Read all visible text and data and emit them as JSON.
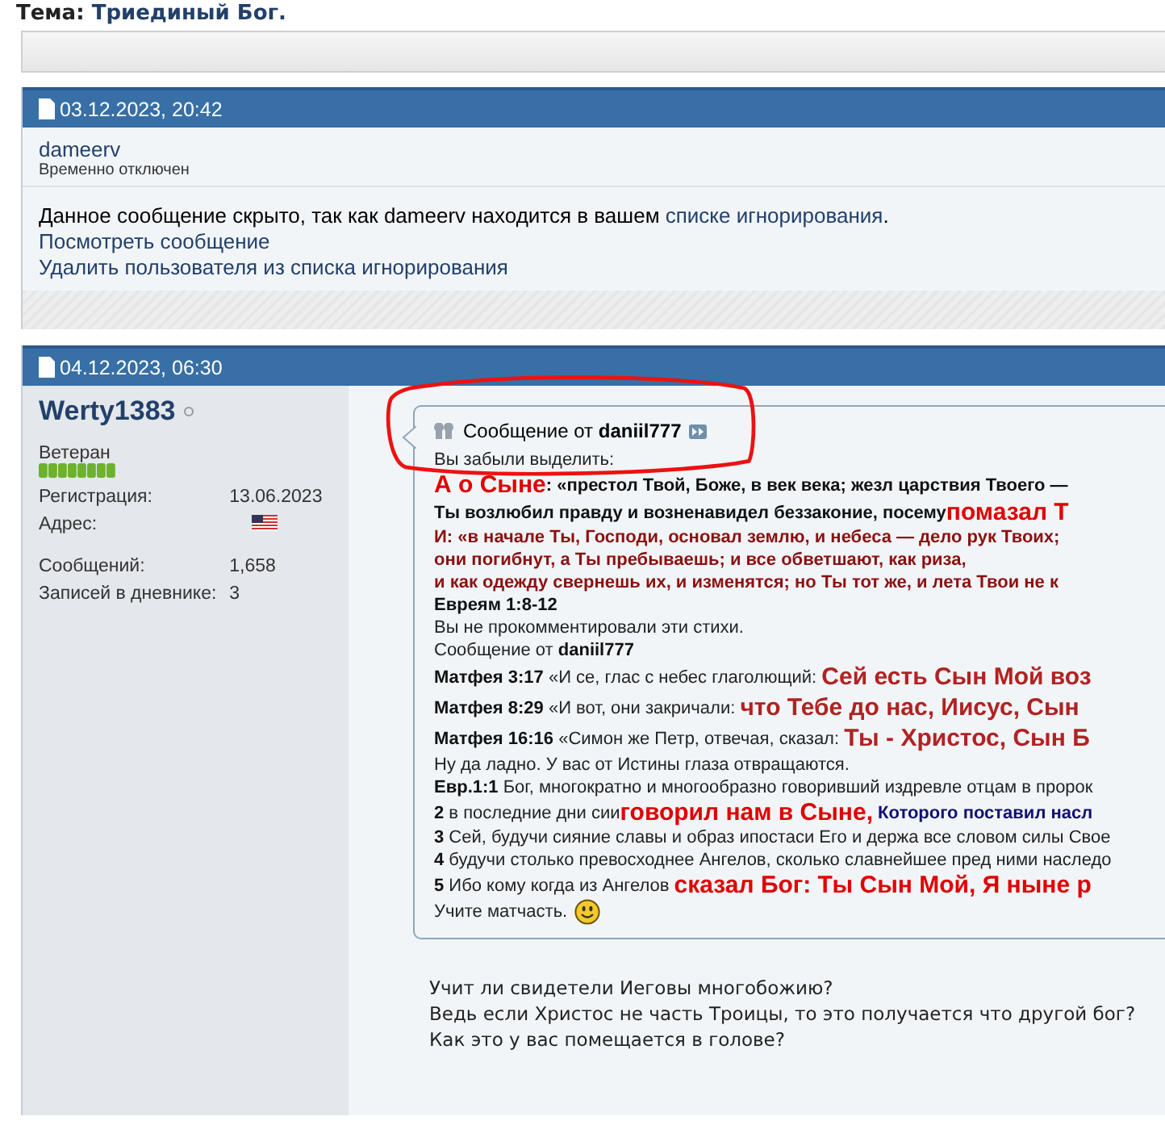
{
  "thread_title": {
    "label": "Тема:",
    "title": "Триединый Бог."
  },
  "posts": [
    {
      "kind": "ignored",
      "date": "03.12.2023, 20:42",
      "author": "dameerv",
      "user_title": "Временно отключен",
      "notice": "Данное сообщение скрыто, так как dameerv находится в вашем ",
      "notice_link": "списке игнорирования",
      "notice_end": ".",
      "links": [
        "Посмотреть сообщение",
        "Удалить пользователя из списка игнорирования"
      ]
    },
    {
      "kind": "full",
      "date": "04.12.2023, 06:30",
      "author": "Werty1383",
      "online": false,
      "rank": "Ветеран",
      "stats": [
        {
          "kind": "text",
          "label": "Регистрация:",
          "value": "13.06.2023"
        },
        {
          "kind": "flag",
          "label": "Адрес:"
        },
        {
          "kind": "gap"
        },
        {
          "kind": "text",
          "label": "Сообщений:",
          "value": "1,658"
        },
        {
          "kind": "text",
          "label": "Записей в дневнике:",
          "value": "3"
        }
      ],
      "quote": {
        "prefix": "Сообщение от",
        "author": "daniil777",
        "lines": [
          [
            {
              "kind": "plain",
              "text": "Вы забыли выделить:"
            }
          ],
          [
            {
              "kind": "bright",
              "text": "А о Сыне"
            },
            {
              "kind": "bold",
              "text": ": «престол Твой, Боже, в век века; жезл царствия Твоего —"
            }
          ],
          [
            {
              "kind": "bold",
              "text": "Ты возлюбил правду и возненавидел беззаконие, посему"
            },
            {
              "kind": "bright",
              "text": "помазал Т"
            }
          ],
          [
            {
              "kind": "darkred",
              "text": "И: «в начале Ты, Господи, основал землю, и небеса — дело рук Твоих;"
            }
          ],
          [
            {
              "kind": "darkred",
              "text": "они погибнут, а Ты пребываешь; и все обветшают, как риза,"
            }
          ],
          [
            {
              "kind": "darkred",
              "text": "и как одежду свернешь их, и изменятся; но Ты тот же, и лета Твои не к"
            }
          ],
          [
            {
              "kind": "bold",
              "text": "Евреям 1:8-12"
            }
          ],
          [
            {
              "kind": "plain",
              "text": "Вы не прокомментировали эти стихи."
            }
          ],
          [
            {
              "kind": "plain",
              "text": "Сообщение от "
            },
            {
              "kind": "bold",
              "text": "daniil777"
            }
          ],
          [
            {
              "kind": "bold",
              "text": "Матфея 3:17"
            },
            {
              "kind": "plain",
              "text": " «И се, глас с небес глаголющий: "
            },
            {
              "kind": "emph",
              "text": "Сей есть Сын Мой воз"
            }
          ],
          [
            {
              "kind": "bold",
              "text": "Матфея 8:29"
            },
            {
              "kind": "plain",
              "text": " «И вот, они закричали: "
            },
            {
              "kind": "emph",
              "text": "что Тебе до нас, Иисус, Сын"
            }
          ],
          [
            {
              "kind": "bold",
              "text": "Матфея 16:16"
            },
            {
              "kind": "plain",
              "text": " «Симон же Петр, отвечая, сказал: "
            },
            {
              "kind": "emph",
              "text": "Ты - Христос, Сын Б"
            }
          ],
          [
            {
              "kind": "plain",
              "text": "Ну да ладно. У вас от Истины глаза отвращаются."
            }
          ],
          [
            {
              "kind": "bold",
              "text": "Евр.1:1"
            },
            {
              "kind": "plain",
              "text": " Бог, многократно и многообразно говоривший издревле отцам в пророк"
            }
          ],
          [
            {
              "kind": "bold",
              "text": "2"
            },
            {
              "kind": "plain",
              "text": " в последние дни сии"
            },
            {
              "kind": "bright",
              "text": "говорил нам в Сыне,"
            },
            {
              "kind": "navy",
              "text": " Которого поставил насл"
            }
          ],
          [
            {
              "kind": "bold",
              "text": "3"
            },
            {
              "kind": "plain",
              "text": " Сей, будучи сияние славы и образ ипостаси Его и держа все словом силы Свое"
            }
          ],
          [
            {
              "kind": "bold",
              "text": "4"
            },
            {
              "kind": "plain",
              "text": " будучи столько превосходнее Ангелов, сколько славнейшее пред ними наследо"
            }
          ],
          [
            {
              "kind": "bold",
              "text": "5"
            },
            {
              "kind": "plain",
              "text": " Ибо кому когда из Ангелов "
            },
            {
              "kind": "bright",
              "text": "сказал Бог: Ты Сын Мой, Я ныне р"
            }
          ],
          [
            {
              "kind": "plain",
              "text": "Учите матчасть."
            },
            {
              "kind": "smiley"
            }
          ]
        ]
      },
      "text": [
        "Учит ли свидетели Иеговы многобожию?",
        "Ведь если Христос не часть Троицы, то это получается что другой бог?",
        "Как это у вас помещается в голове?"
      ]
    }
  ]
}
